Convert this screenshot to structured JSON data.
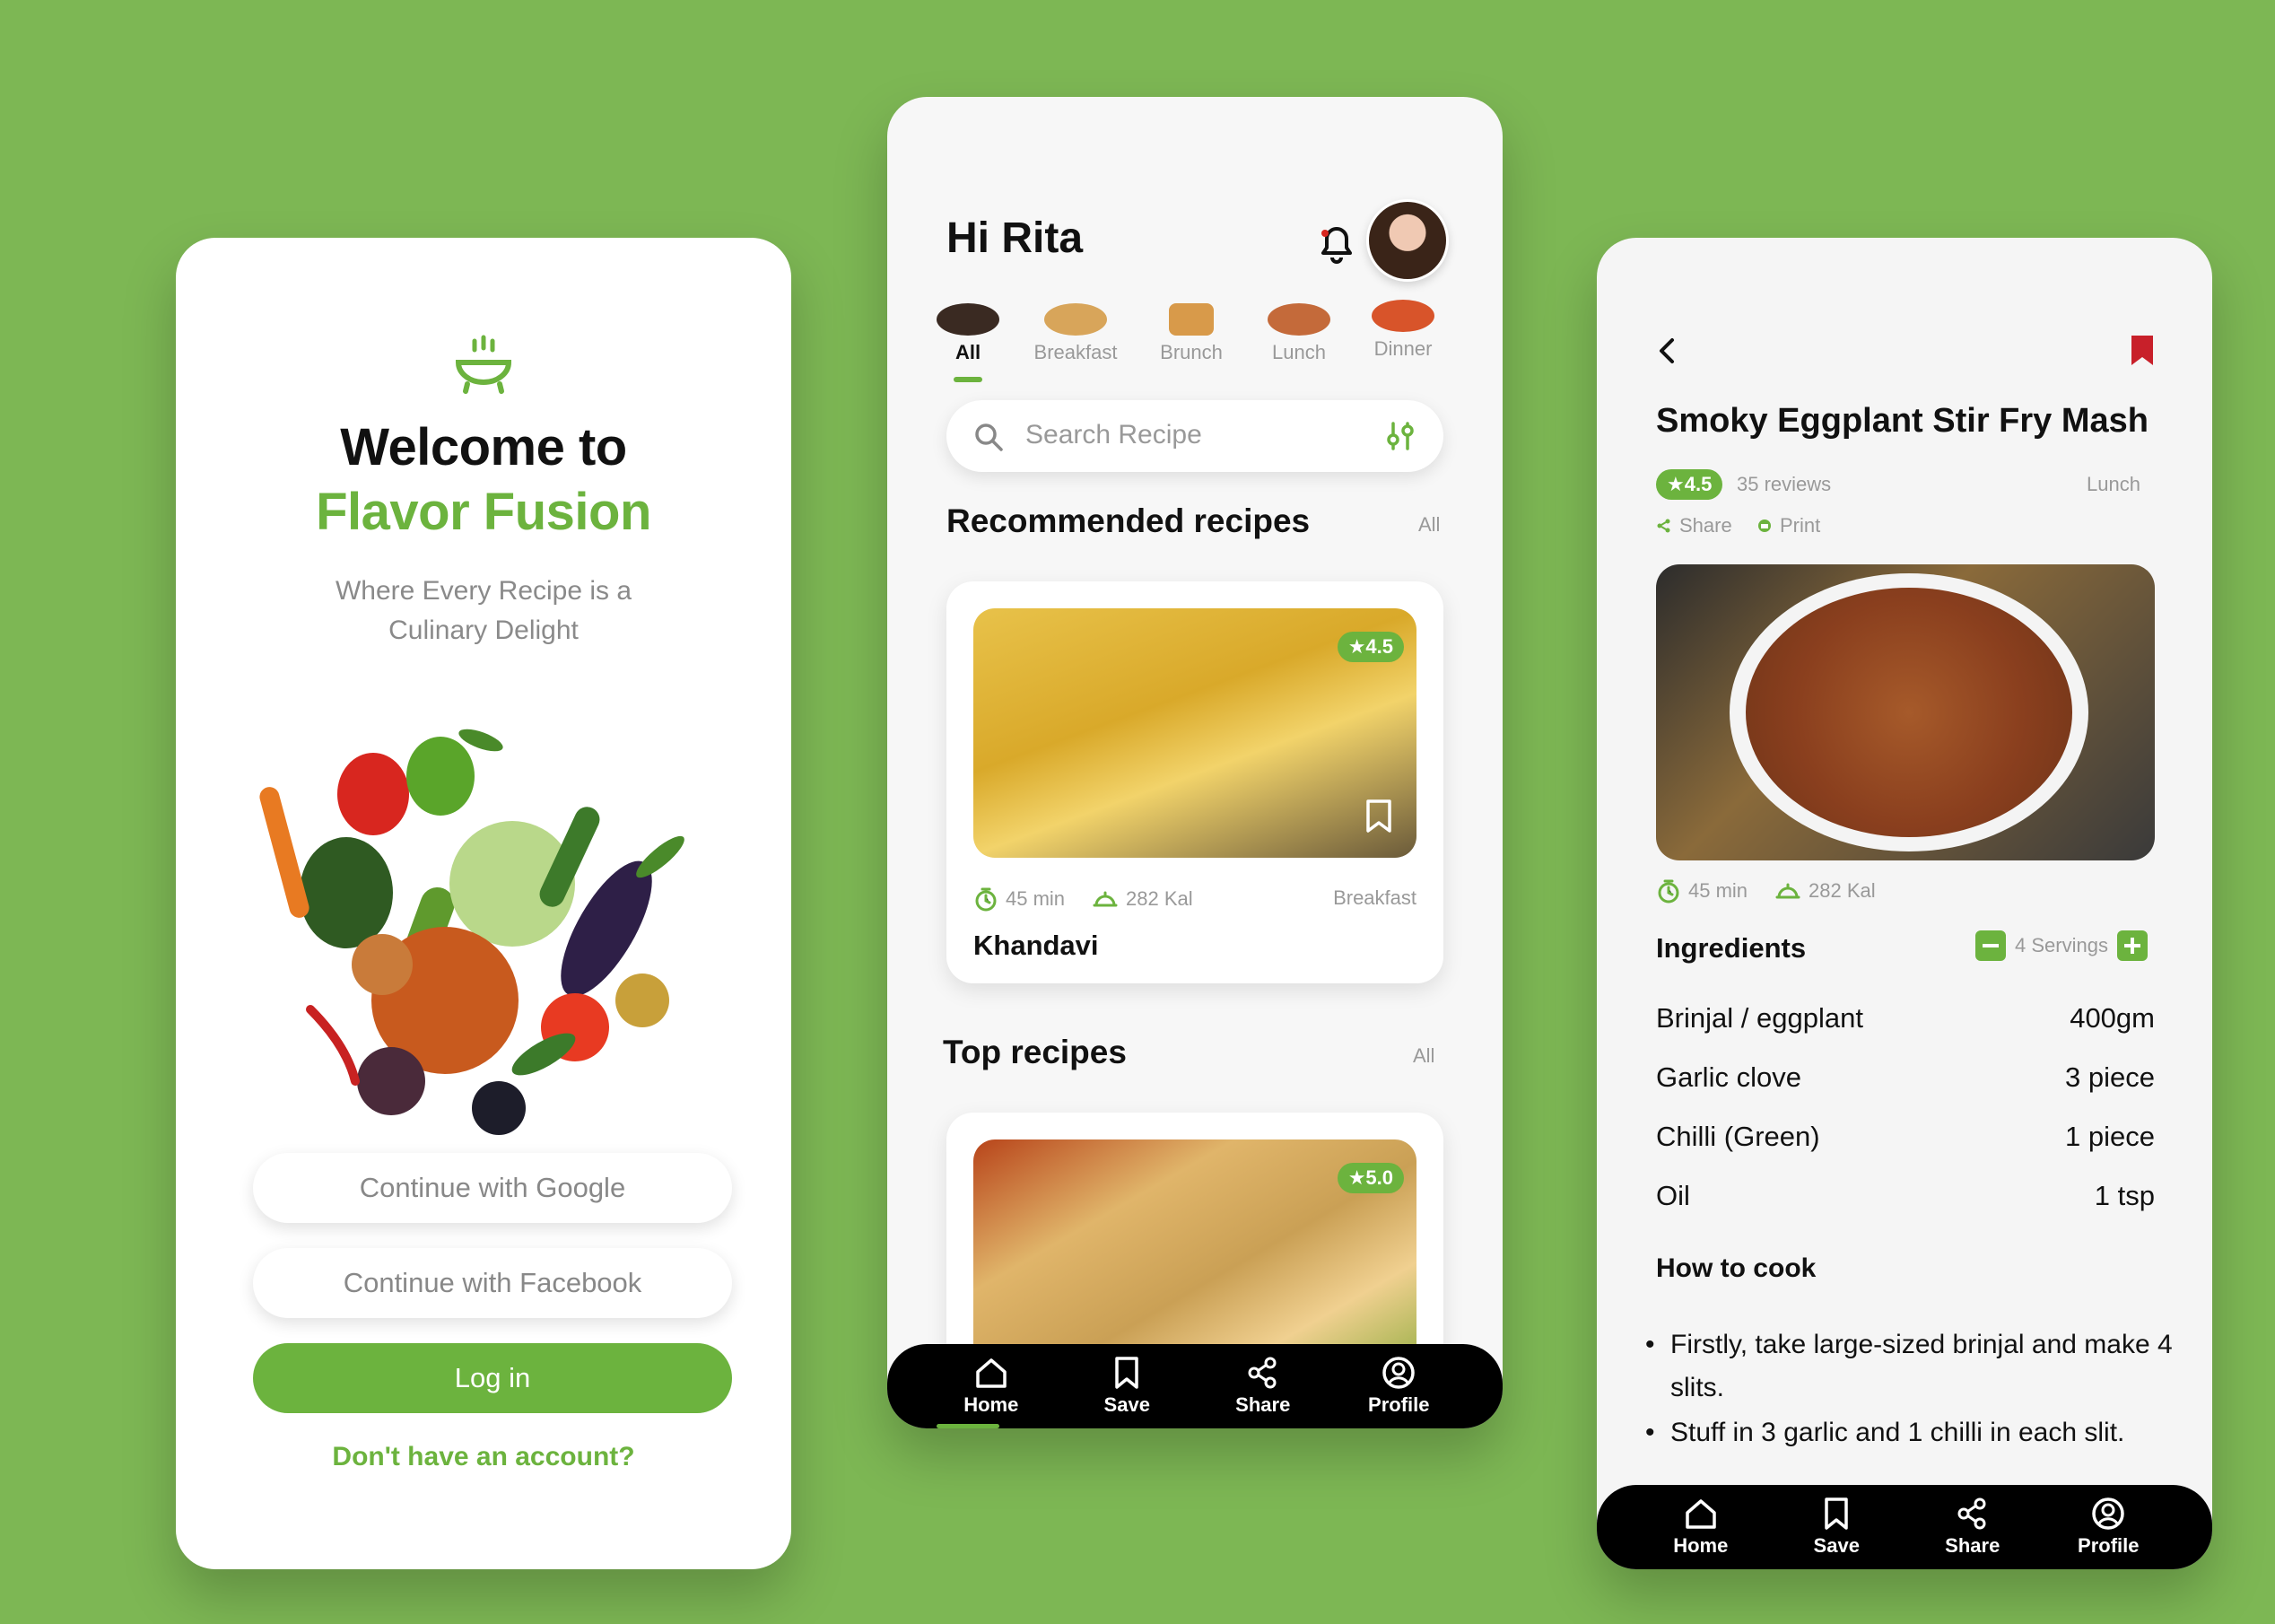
{
  "brand": {
    "accent": "#6cb33e",
    "background": "#7db754"
  },
  "welcome": {
    "title_line1": "Welcome to",
    "title_line2": "Flavor Fusion",
    "subtitle_line1": "Where Every Recipe is a",
    "subtitle_line2": "Culinary Delight",
    "google_button": "Continue with Google",
    "facebook_button": "Continue with Facebook",
    "login_button": "Log in",
    "signup_link": "Don't have an account?"
  },
  "home": {
    "greeting": "Hi Rita",
    "categories": [
      {
        "label": "All",
        "active": true
      },
      {
        "label": "Breakfast",
        "active": false
      },
      {
        "label": "Brunch",
        "active": false
      },
      {
        "label": "Lunch",
        "active": false
      },
      {
        "label": "Dinner",
        "active": false
      }
    ],
    "search": {
      "placeholder": "Search Recipe"
    },
    "recommended": {
      "title": "Recommended recipes",
      "all_link": "All",
      "card": {
        "rating": "★4.5",
        "time": "45 min",
        "calories": "282 Kal",
        "category": "Breakfast",
        "name": "Khandavi"
      }
    },
    "top": {
      "title": "Top recipes",
      "all_link": "All",
      "card": {
        "rating": "★5.0"
      }
    }
  },
  "nav": {
    "home": "Home",
    "save": "Save",
    "share": "Share",
    "profile": "Profile"
  },
  "detail": {
    "title": "Smoky Eggplant Stir Fry Mash",
    "rating": "★4.5",
    "reviews": "35 reviews",
    "category": "Lunch",
    "share": "Share",
    "print": "Print",
    "time": "45 min",
    "calories": "282 Kal",
    "ingredients_title": "Ingredients",
    "servings": "4 Servings",
    "ingredients": [
      {
        "name": "Brinjal / eggplant",
        "qty": "400gm"
      },
      {
        "name": "Garlic clove",
        "qty": "3 piece"
      },
      {
        "name": "Chilli (Green)",
        "qty": "1 piece"
      },
      {
        "name": "Oil",
        "qty": "1 tsp"
      }
    ],
    "how_to_cook": "How to cook",
    "steps": [
      "Firstly, take large-sized brinjal and make 4 slits.",
      "Stuff in 3 garlic and 1 chilli in each slit."
    ]
  }
}
